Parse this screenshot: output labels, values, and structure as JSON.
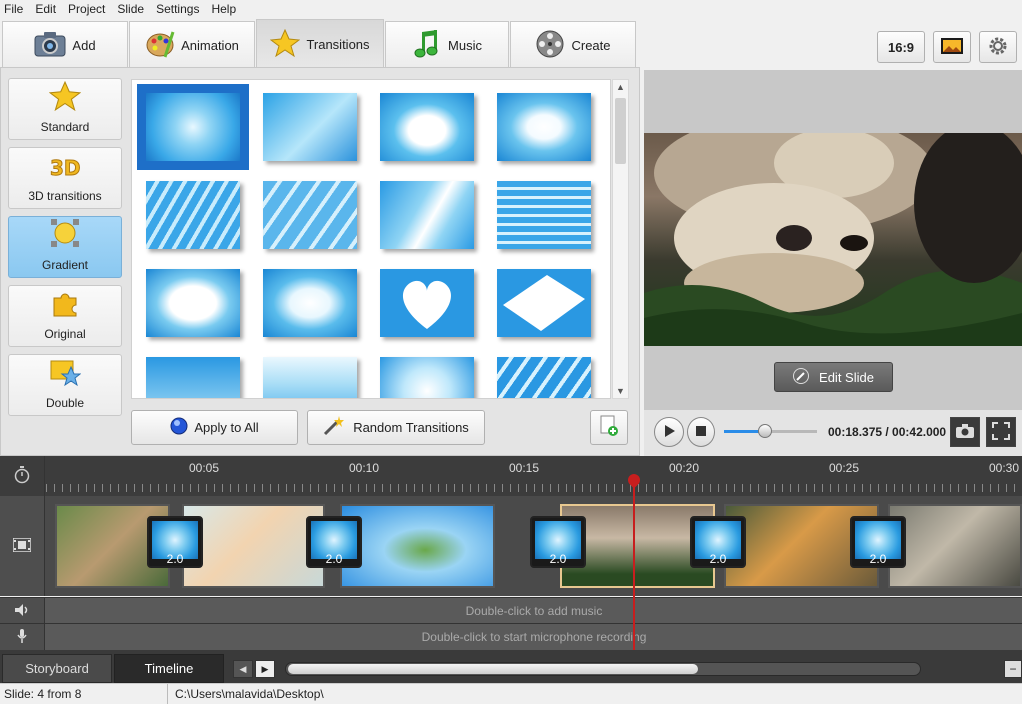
{
  "menu": [
    "File",
    "Edit",
    "Project",
    "Slide",
    "Settings",
    "Help"
  ],
  "tabs": {
    "add": "Add",
    "animation": "Animation",
    "transitions": "Transitions",
    "music": "Music",
    "create": "Create"
  },
  "categories": [
    "Standard",
    "3D transitions",
    "Gradient",
    "Original",
    "Double"
  ],
  "buttons": {
    "apply_all": "Apply to All",
    "random": "Random Transitions",
    "aspect": "16:9",
    "edit_slide": "Edit Slide"
  },
  "player": {
    "time": "00:18.375 / 00:42.000",
    "progress": 0.44
  },
  "ruler_ticks": [
    "00:05",
    "00:10",
    "00:15",
    "00:20",
    "00:25",
    "00:30"
  ],
  "transition_durations": [
    "2.0",
    "2.0",
    "2.0",
    "2.0",
    "2.0"
  ],
  "tracks": {
    "music_hint": "Double-click to add music",
    "mic_hint": "Double-click to start microphone recording"
  },
  "bottom_tabs": {
    "storyboard": "Storyboard",
    "timeline": "Timeline"
  },
  "status": {
    "slide": "Slide: 4 from 8",
    "path": "C:\\Users\\malavida\\Desktop\\"
  },
  "colors": {
    "selection": "#1e6fc8",
    "playhead": "#c81e1e",
    "accent": "#8ac8f0"
  }
}
